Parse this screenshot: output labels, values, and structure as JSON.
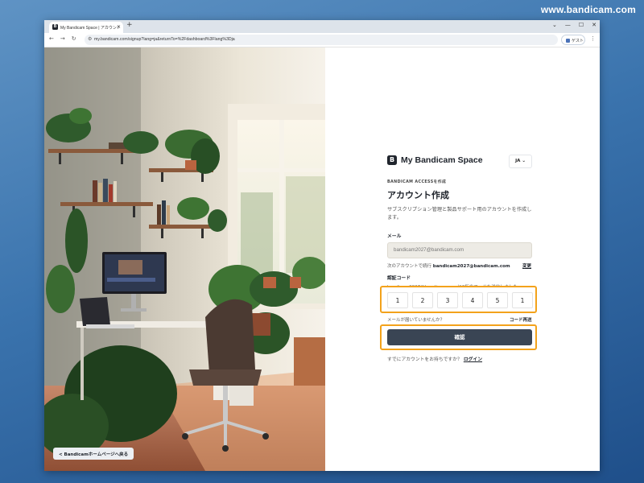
{
  "watermark": "www.bandicam.com",
  "browser": {
    "tab_title": "My Bandicam Space | アカウント",
    "tab_icon": "B",
    "url": "my.bandicam.com/signup?lang=ja&returnTo=%2Fdashboard%3Flang%3Dja",
    "profile_label": "ゲスト"
  },
  "hero": {
    "back_link": "<  Bandicamホームページへ戻る"
  },
  "brand": {
    "logo_letter": "B",
    "name": "My Bandicam Space",
    "language": "JA"
  },
  "form": {
    "eyebrow": "BANDICAM ACCESSを作成",
    "title": "アカウント作成",
    "description": "サブスクリプション管理と製品サポート用のアカウントを作成します。",
    "email_label": "メール",
    "email_value": "bandicam2027@bandicam.com",
    "continue_prefix": "次のアカウントで続行",
    "continue_email": "bandicam2027@bandicam.com",
    "change_label": "変更",
    "code_label": "認証コード",
    "code_hint": "bandicam2027@bandicam.comに6桁のコードを送信しました。",
    "code_digits": [
      "1",
      "2",
      "3",
      "4",
      "5",
      "1"
    ],
    "no_email": "メールが届いていませんか？",
    "resend_label": "コード再送",
    "verify_label": "確認",
    "have_account": "すでにアカウントをお持ちですか？",
    "login_label": "ログイン"
  },
  "colors": {
    "highlight": "#f3a21b",
    "primary_button": "#3a4554",
    "desktop": "#3a73ad"
  }
}
